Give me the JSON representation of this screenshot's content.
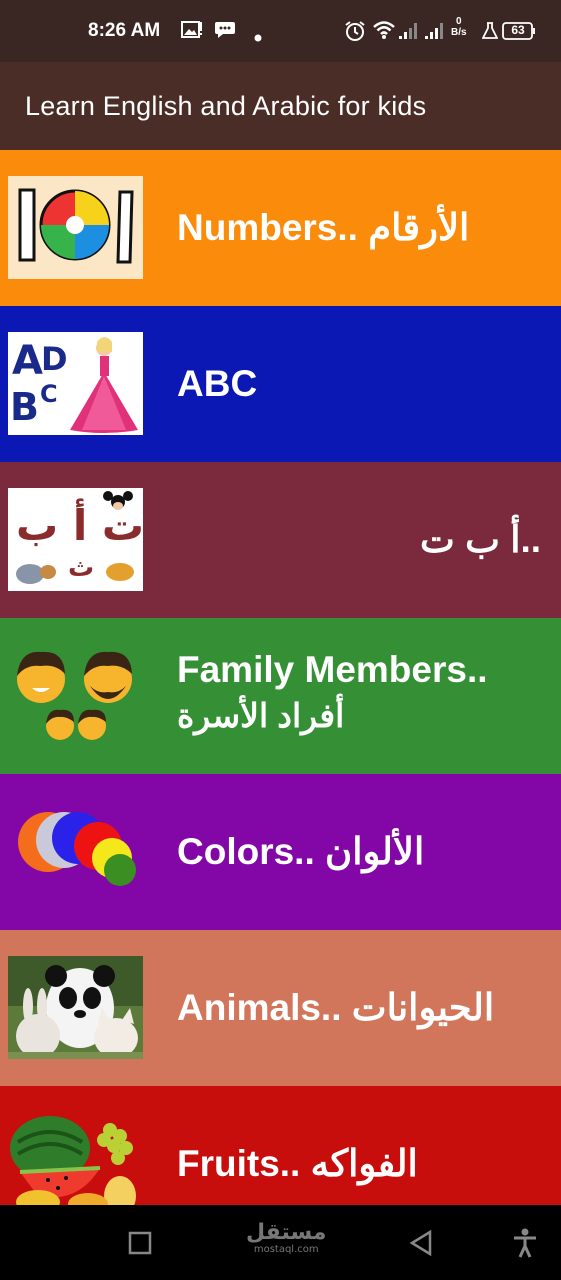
{
  "status_bar": {
    "time": "8:26 AM",
    "net_speed_value": "0",
    "net_speed_unit": "B/s",
    "battery": "63"
  },
  "app_bar": {
    "title": "Learn English and Arabic for kids"
  },
  "items": [
    {
      "label": "Numbers.. الأرقام",
      "bg": "#fb8c0b",
      "icon": "numbers-101-ball-icon"
    },
    {
      "label": "ABC",
      "bg": "#0b18b3",
      "icon": "abc-doll-icon"
    },
    {
      "label": "أ ب ت..",
      "bg": "#7b2a3e",
      "icon": "arabic-letters-cartoon-icon"
    },
    {
      "label_line1": "Family Members..",
      "label_line2": "أفراد الأسرة",
      "bg": "#358f35",
      "icon": "family-faces-icon"
    },
    {
      "label": "Colors.. الألوان",
      "bg": "#8307a6",
      "icon": "color-circles-icon"
    },
    {
      "label": "Animals.. الحيوانات",
      "bg": "#d1755b",
      "icon": "animals-panda-icon"
    },
    {
      "label": "Fruits.. الفواكه",
      "bg": "#c80d0d",
      "icon": "fruits-watermelon-icon"
    }
  ],
  "nav_bar": {
    "watermark_arabic": "مستقل",
    "watermark_latin": "mostaql.com"
  }
}
